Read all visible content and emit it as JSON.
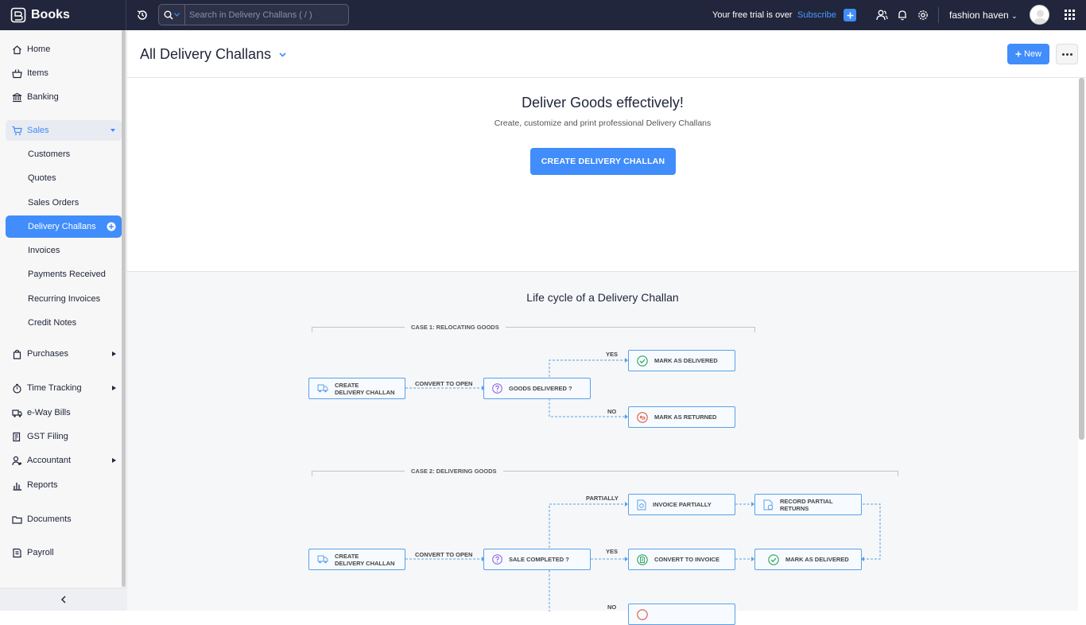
{
  "app": {
    "name": "Books"
  },
  "search": {
    "placeholder": "Search in Delivery Challans ( / )"
  },
  "topbar": {
    "trial_text": "Your free trial is over",
    "subscribe_label": "Subscribe",
    "org_name": "fashion haven"
  },
  "sidebar": {
    "home": "Home",
    "items": "Items",
    "banking": "Banking",
    "sales": "Sales",
    "sales_sub": [
      "Customers",
      "Quotes",
      "Sales Orders",
      "Delivery Challans",
      "Invoices",
      "Payments Received",
      "Recurring Invoices",
      "Credit Notes"
    ],
    "purchases": "Purchases",
    "time_tracking": "Time Tracking",
    "eway": "e-Way Bills",
    "gst": "GST Filing",
    "accountant": "Accountant",
    "reports": "Reports",
    "documents": "Documents",
    "payroll": "Payroll"
  },
  "header": {
    "title": "All Delivery Challans",
    "new_label": "New"
  },
  "hero": {
    "title": "Deliver Goods effectively!",
    "subtitle": "Create, customize and print professional Delivery Challans",
    "cta": "CREATE DELIVERY CHALLAN"
  },
  "lifecycle": {
    "title": "Life cycle of a Delivery Challan",
    "case1": {
      "label": "CASE 1: RELOCATING GOODS",
      "create": [
        "CREATE",
        "DELIVERY CHALLAN"
      ],
      "edge": "CONVERT TO OPEN",
      "question": "GOODS DELIVERED ?",
      "yes": "YES",
      "no": "NO",
      "delivered": "MARK AS DELIVERED",
      "returned": "MARK AS RETURNED"
    },
    "case2": {
      "label": "CASE 2: DELIVERING GOODS",
      "create": [
        "CREATE",
        "DELIVERY CHALLAN"
      ],
      "edge": "CONVERT TO OPEN",
      "question": "SALE COMPLETED ?",
      "partially": "PARTIALLY",
      "yes": "YES",
      "no": "NO",
      "invoice_partially": "INVOICE PARTIALLY",
      "record_returns": [
        "RECORD PARTIAL",
        "RETURNS"
      ],
      "convert_invoice": "CONVERT TO INVOICE",
      "delivered": "MARK AS DELIVERED"
    }
  }
}
